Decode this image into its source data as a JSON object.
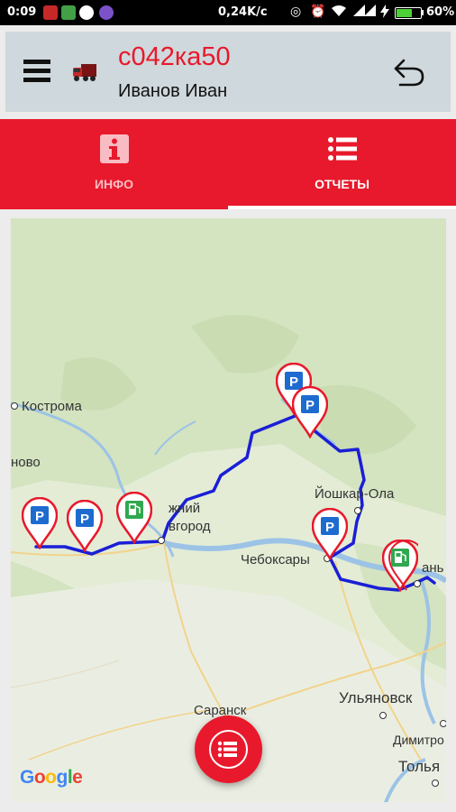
{
  "status_bar": {
    "time": "0:09",
    "network_speed": "0,24K/c",
    "battery_percent": "60%",
    "battery_level": 0.6,
    "icons": [
      "app-icon-red",
      "app-icon-green",
      "app-icon-odnoklassniki",
      "app-icon-viber",
      "data-saver-icon",
      "alarm-icon",
      "wifi-icon",
      "signal-icon",
      "signal-icon",
      "charging-icon",
      "battery-icon"
    ]
  },
  "header": {
    "vehicle_plate": "с042ка50",
    "driver_name": "Иванов Иван",
    "icons": {
      "menu": "menu-icon",
      "vehicle": "truck-icon",
      "back": "back-arrow-icon"
    }
  },
  "tabs": [
    {
      "label": "ИНФО",
      "icon": "info-icon",
      "active": false
    },
    {
      "label": "ОТЧЕТЫ",
      "icon": "list-icon",
      "active": true
    }
  ],
  "map": {
    "cities": [
      {
        "name": "Кострома"
      },
      {
        "name": "ново"
      },
      {
        "name": "жний"
      },
      {
        "name": "вгород"
      },
      {
        "name": "Йошкар-Ола"
      },
      {
        "name": "Чебоксары"
      },
      {
        "name": "ань"
      },
      {
        "name": "Саранск"
      },
      {
        "name": "Ульяновск"
      },
      {
        "name": "Димитро"
      },
      {
        "name": "Толья"
      }
    ],
    "markers": [
      {
        "type": "parking",
        "label": "P"
      },
      {
        "type": "parking",
        "label": "P"
      },
      {
        "type": "fuel",
        "label": ""
      },
      {
        "type": "parking",
        "label": "P"
      },
      {
        "type": "parking",
        "label": "P"
      },
      {
        "type": "parking",
        "label": "P"
      },
      {
        "type": "fuel",
        "label": ""
      }
    ],
    "route_color": "#1a1fd6",
    "attribution": "Google"
  },
  "fab": {
    "icon": "list-icon"
  },
  "colors": {
    "accent": "#e8192c",
    "header_bg": "#cfd8dc",
    "parking_marker": "#1e6bd0",
    "fuel_marker": "#2fa84f"
  }
}
